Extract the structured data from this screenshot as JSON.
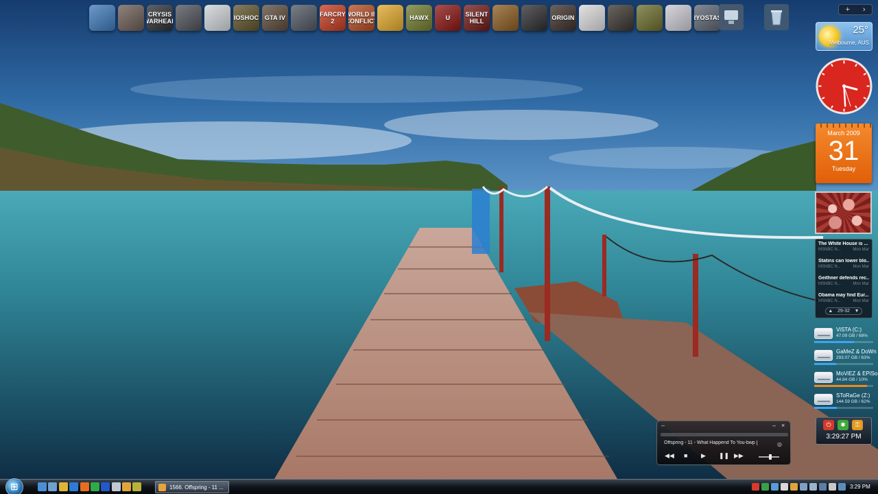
{
  "dock": {
    "icons": [
      {
        "label": "",
        "icon": "computer-icon",
        "bg": "#3d78b8"
      },
      {
        "label": "",
        "icon": "predator-icon",
        "bg": "#6a5a52"
      },
      {
        "label": "CRYSIS WARHEAD",
        "icon": "crysis-icon",
        "bg": "#2b2f33"
      },
      {
        "label": "",
        "icon": "soldier-icon",
        "bg": "#4d5058"
      },
      {
        "label": "",
        "icon": "assassin-icon",
        "bg": "#cfd3d6"
      },
      {
        "label": "BIOSHOCK",
        "icon": "bioshock-icon",
        "bg": "#5d5228"
      },
      {
        "label": "GTA IV",
        "icon": "gta-icon",
        "bg": "#5a4a3a"
      },
      {
        "label": "",
        "icon": "knight-icon",
        "bg": "#4e5560"
      },
      {
        "label": "FARCRY 2",
        "icon": "farcry-icon",
        "bg": "#c23a1e"
      },
      {
        "label": "WORLD IN CONFLICT",
        "icon": "conflict-icon",
        "bg": "#b44a1f"
      },
      {
        "label": "",
        "icon": "fallout-icon",
        "bg": "#e0a72b"
      },
      {
        "label": "HAWX",
        "icon": "hawx-icon",
        "bg": "#6f7a2e"
      },
      {
        "label": "U",
        "icon": "unreal-icon",
        "bg": "#8a1412"
      },
      {
        "label": "SILENT HILL",
        "icon": "silenthill-icon",
        "bg": "#6e1816"
      },
      {
        "label": "",
        "icon": "race-icon",
        "bg": "#8a5a20"
      },
      {
        "label": "",
        "icon": "car-icon",
        "bg": "#2c2c30"
      },
      {
        "label": "ORIGIN",
        "icon": "origin-icon",
        "bg": "#3b2f2a"
      },
      {
        "label": "",
        "icon": "mirrors-edge-icon",
        "bg": "#d9d9d9"
      },
      {
        "label": "",
        "icon": "fear-icon",
        "bg": "#38332c"
      },
      {
        "label": "",
        "icon": "raceline-icon",
        "bg": "#6a6b2a"
      },
      {
        "label": "",
        "icon": "burnout-icon",
        "bg": "#c8c8d0"
      },
      {
        "label": "CRYOSTASIS",
        "icon": "cryostasis-icon",
        "bg": "#5c6470"
      }
    ],
    "extra": [
      {
        "icon": "network-icon",
        "bg": "#46586d"
      },
      {
        "icon": "recycle-bin-icon",
        "bg": "#3f5872"
      }
    ]
  },
  "sidebar_controls": {
    "add": "+",
    "next": "›"
  },
  "weather": {
    "temp": "25°",
    "location": "Melbourne, AUS"
  },
  "clock": {
    "hour": 3,
    "minute": 29,
    "second": 27
  },
  "calendar": {
    "month": "March 2009",
    "day": "31",
    "weekday": "Tuesday"
  },
  "news": {
    "items": [
      {
        "headline": "The White House is ...",
        "source": "MSNBC N...",
        "date": "Mon Mar"
      },
      {
        "headline": "Statins can lower blo...",
        "source": "MSNBC N...",
        "date": "Mon Mar"
      },
      {
        "headline": "Geithner defends rec...",
        "source": "MSNBC N...",
        "date": "Mon Mar"
      },
      {
        "headline": "Obama may find Eur...",
        "source": "MSNBC N...",
        "date": "Mon Mar"
      }
    ],
    "pager": "29-32",
    "prev": "▲",
    "next": "▼"
  },
  "drives": [
    {
      "name": "ViSTA (C:)",
      "info": "47.09 GB / 68%",
      "used": 0.68,
      "color": "#3fa4f0"
    },
    {
      "name": "GaMeZ & DoWn",
      "info": "293.07 GB / 63%",
      "used": 0.37,
      "color": "#3fa4f0"
    },
    {
      "name": "MoViEZ & EPiSo",
      "info": "44.84 GB / 10%",
      "used": 0.9,
      "color": "#f08a1c"
    },
    {
      "name": "SToRaGe (Z:)",
      "info": "144.59 GB / 62%",
      "used": 0.38,
      "color": "#3fa4f0"
    }
  ],
  "shutdown": {
    "time": "3:29:27 PM"
  },
  "player": {
    "track": "Offspring - 11 - What Happend To You-bwp [",
    "minimize": "–",
    "close": "×",
    "rewind": "◀◀",
    "stop": "■",
    "play": "▶",
    "pause": "❚❚",
    "forward": "▶▶"
  },
  "taskbar": {
    "task_label": "1566. Offspring - 11 ...",
    "time": "3:29 PM"
  }
}
